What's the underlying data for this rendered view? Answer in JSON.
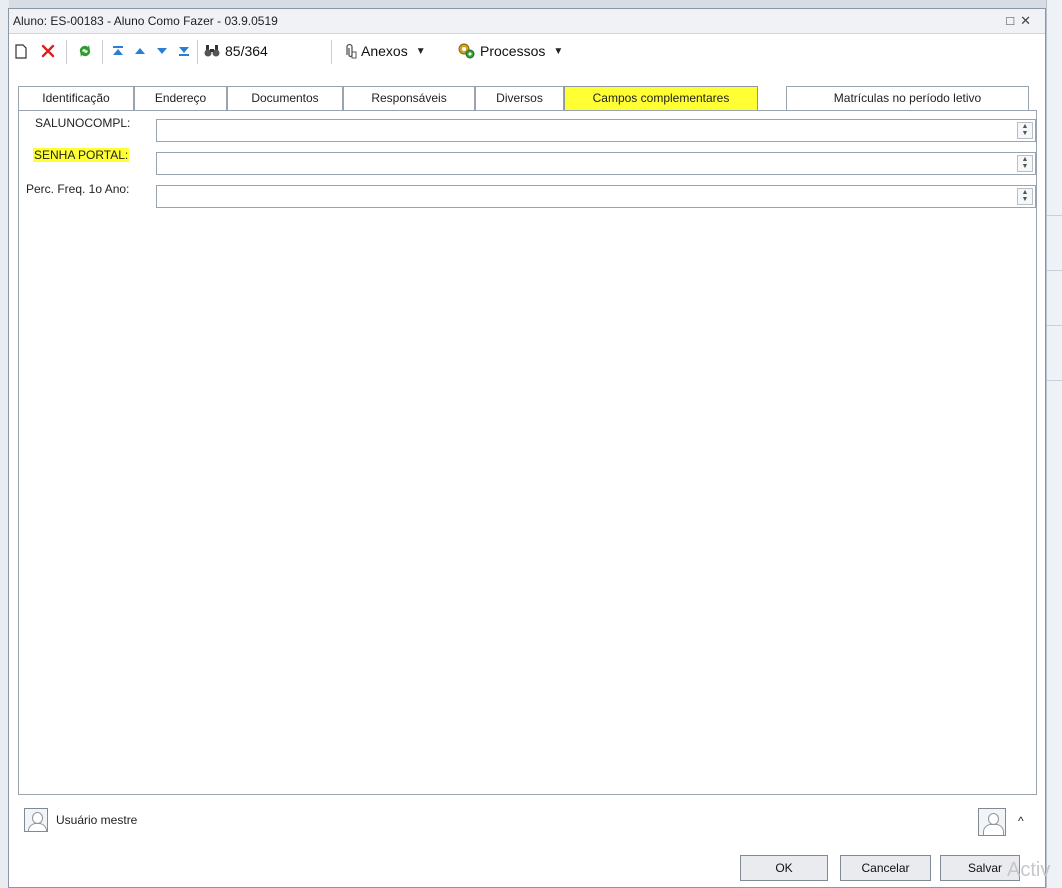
{
  "window": {
    "title": "Aluno: ES-00183 - Aluno Como Fazer - 03.9.0519",
    "restore_glyph": "□",
    "close_glyph": "✕"
  },
  "toolbar": {
    "record_position": "85/364",
    "attachments_label": "Anexos",
    "processes_label": "Processos",
    "icons": [
      "new-icon",
      "delete-icon",
      "refresh-icon",
      "first-record-icon",
      "previous-record-icon",
      "next-record-icon",
      "last-record-icon",
      "find-icon",
      "paperclip-icon",
      "processes-icon"
    ]
  },
  "tabs": [
    {
      "label": "Identificação"
    },
    {
      "label": "Endereço"
    },
    {
      "label": "Documentos"
    },
    {
      "label": "Responsáveis"
    },
    {
      "label": "Diversos"
    },
    {
      "label": "Campos complementares",
      "active": true
    },
    {
      "label": "Matrículas no período letivo"
    }
  ],
  "fields": [
    {
      "label": "SALUNOCOMPL:",
      "value": ""
    },
    {
      "label": "SENHA PORTAL:",
      "value": "",
      "highlight": true
    },
    {
      "label": "Perc. Freq. 1o Ano:",
      "value": ""
    }
  ],
  "footer": {
    "user_label": "Usuário mestre",
    "ok_label": "OK",
    "cancel_label": "Cancelar",
    "save_label": "Salvar",
    "watermark": "Activ"
  },
  "colors": {
    "highlight": "#ffff33",
    "delete_icon": "#e02020",
    "refresh_icon": "#2f9a2f",
    "nav_arrows": "#2a7fd4"
  }
}
